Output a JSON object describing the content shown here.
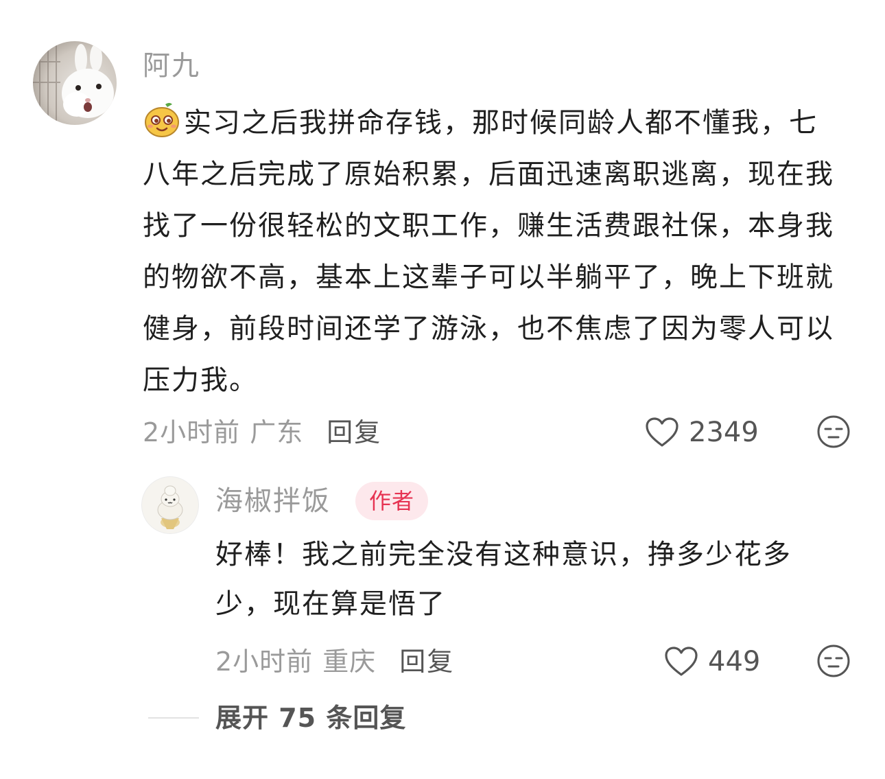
{
  "comment": {
    "username": "阿九",
    "avatar_icon": "rabbit-avatar",
    "emoji_icon": "smirk-emoji-icon",
    "text": "实习之后我拼命存钱，那时候同龄人都不懂我，七八年之后完成了原始积累，后面迅速离职逃离，现在我找了一份很轻松的文职工作，赚生活费跟社保，本身我的物欲不高，基本上这辈子可以半躺平了，晚上下班就健身，前段时间还学了游泳，也不焦虑了因为零人可以压力我。",
    "time": "2小时前",
    "location": "广东",
    "reply_label": "回复",
    "like_count": "2349",
    "like_icon": "heart-outline-icon",
    "dislike_icon": "unamused-face-icon"
  },
  "reply": {
    "username": "海椒拌饭",
    "badge": "作者",
    "avatar_icon": "onigiri-avatar",
    "text": "好棒！我之前完全没有这种意识，挣多少花多少，现在算是悟了",
    "time": "2小时前",
    "location": "重庆",
    "reply_label": "回复",
    "like_count": "449",
    "like_icon": "heart-outline-icon",
    "dislike_icon": "unamused-face-icon"
  },
  "expand": {
    "label": "展开 75 条回复"
  },
  "colors": {
    "muted_text": "#9a9a9a",
    "body_text": "#1f1f1f",
    "badge_bg": "#fde8ec",
    "badge_text": "#e63352"
  }
}
